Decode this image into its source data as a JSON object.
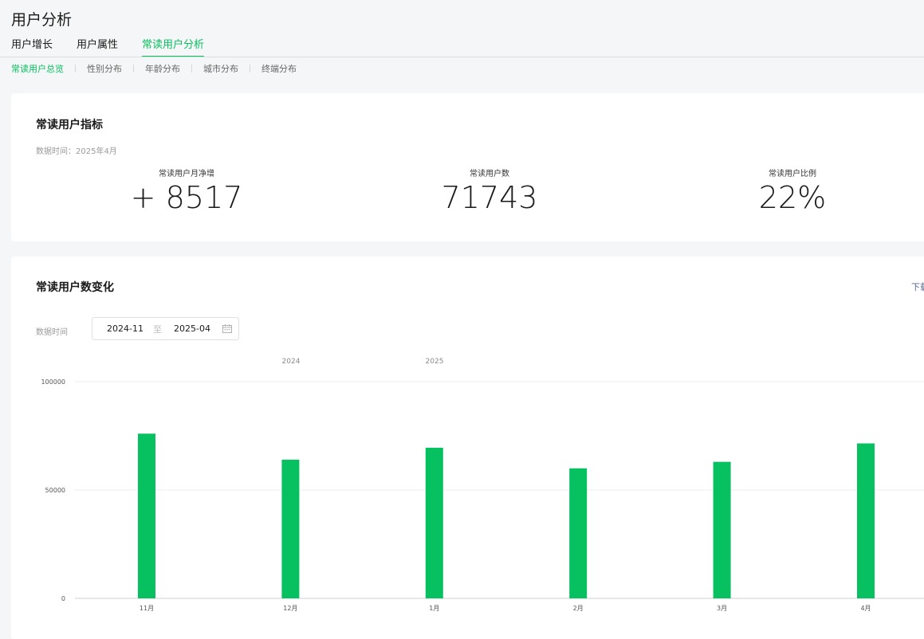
{
  "page": {
    "title": "用户分析"
  },
  "tabs": [
    "用户增长",
    "用户属性",
    "常读用户分析"
  ],
  "sub_tabs": [
    "常读用户总览",
    "性别分布",
    "年龄分布",
    "城市分布",
    "终端分布"
  ],
  "indicators": {
    "title": "常读用户指标",
    "data_time": "数据时间：2025年4月",
    "metrics": [
      {
        "label": "常读用户月净增",
        "value": "+ 8517"
      },
      {
        "label": "常读用户数",
        "value": "71743"
      },
      {
        "label": "常读用户比例",
        "value": "22%"
      }
    ]
  },
  "trend": {
    "title": "常读用户数变化",
    "download_label": "下载",
    "range_label": "数据时间",
    "range_start": "2024-11",
    "range_sep": "至",
    "range_end": "2025-04",
    "icons": {
      "calendar": "calendar-icon"
    }
  },
  "colors": {
    "accent": "#07c160",
    "link": "#576b95"
  },
  "chart_data": {
    "type": "bar",
    "categories": [
      "11月",
      "12月",
      "1月",
      "2月",
      "3月",
      "4月"
    ],
    "year_labels": [
      "2024",
      "2025"
    ],
    "values": [
      76000,
      64000,
      69500,
      60000,
      63000,
      71500
    ],
    "ylim": [
      0,
      100000
    ],
    "yticks": [
      0,
      50000,
      100000
    ],
    "ytick_labels": [
      "0",
      "50000",
      "100000"
    ],
    "grid": true,
    "color": "#07c160"
  }
}
